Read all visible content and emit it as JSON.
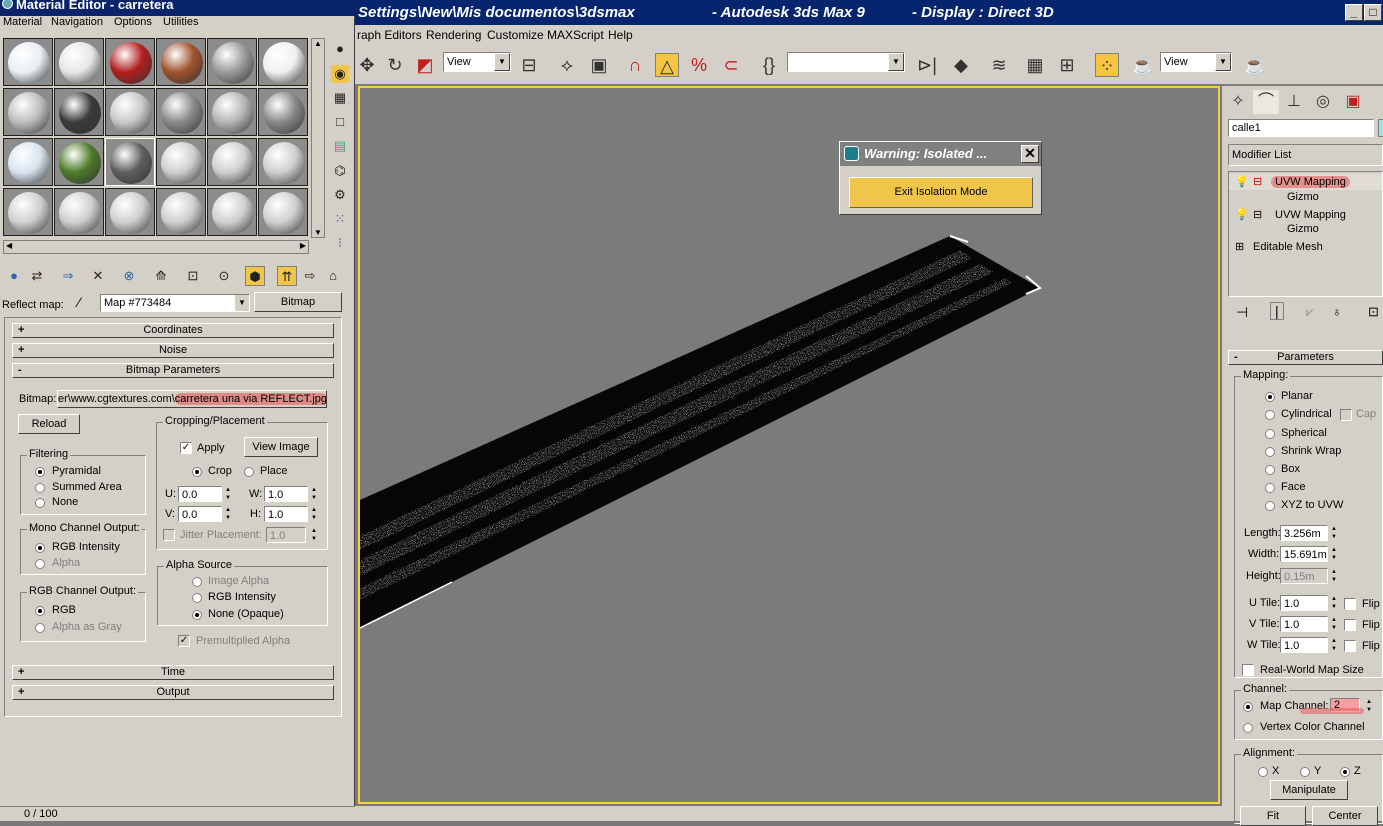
{
  "max_window": {
    "title_path": "Settings\\New\\Mis documentos\\3dsmax",
    "title_app": "- Autodesk 3ds Max 9",
    "title_display": "- Display : Direct 3D",
    "minimize": "_",
    "restore": "□",
    "menu": [
      "raph Editors",
      "Rendering",
      "Customize",
      "MAXScript",
      "Help"
    ],
    "toolbar": {
      "ref_coord": "View",
      "named_selection": "",
      "render_view": "View"
    }
  },
  "warning_dialog": {
    "title": "Warning: Isolated ...",
    "close": "✕",
    "button": "Exit Isolation Mode"
  },
  "material_editor": {
    "title": "Material Editor - carretera",
    "menu": [
      "Material",
      "Navigation",
      "Options",
      "Utilities"
    ],
    "slot_colors": [
      [
        "#e8eef4",
        "#e6e6e6",
        "#b21e1e",
        "#a0522d",
        "#9a9a9a",
        "#f0f0f0"
      ],
      [
        "#bdbdbd",
        "#3a3a3a",
        "#c8c8c8",
        "#8a8a8a",
        "#b5b5b5",
        "#888888"
      ],
      [
        "#d8e4ee",
        "#4e7a2a",
        "#5e5e5e",
        "#cfcfcf",
        "#cfcfcf",
        "#cfcfcf"
      ],
      [
        "#cfcfcf",
        "#cfcfcf",
        "#cfcfcf",
        "#cfcfcf",
        "#cfcfcf",
        "#cfcfcf"
      ]
    ],
    "reflect_label": "Reflect map:",
    "map_name": "Map #773484",
    "map_type": "Bitmap",
    "rollouts": {
      "coordinates": "Coordinates",
      "noise": "Noise",
      "bitmap_params": "Bitmap Parameters",
      "time": "Time",
      "output": "Output"
    },
    "bitmap_label": "Bitmap:",
    "bitmap_path_prefix": "er\\www.cgtextures.com\\",
    "bitmap_path_file": "carretera una via REFLECT.jpg",
    "reload": "Reload",
    "filtering": {
      "title": "Filtering",
      "options": [
        "Pyramidal",
        "Summed Area",
        "None"
      ]
    },
    "mono_output": {
      "title": "Mono Channel Output:",
      "options": [
        "RGB Intensity",
        "Alpha"
      ]
    },
    "rgb_output": {
      "title": "RGB Channel Output:",
      "options": [
        "RGB",
        "Alpha as Gray"
      ]
    },
    "cropping": {
      "title": "Cropping/Placement",
      "apply": "Apply",
      "view_image": "View Image",
      "crop": "Crop",
      "place": "Place",
      "u_label": "U:",
      "u": "0.0",
      "v_label": "V:",
      "v": "0.0",
      "w_label": "W:",
      "w": "1.0",
      "h_label": "H:",
      "h": "1.0",
      "jitter": "Jitter Placement:",
      "jitter_val": "1.0"
    },
    "alpha_source": {
      "title": "Alpha Source",
      "options": [
        "Image Alpha",
        "RGB Intensity",
        "None (Opaque)"
      ]
    },
    "premultiplied": "Premultiplied Alpha",
    "timebar": "0 / 100"
  },
  "command_panel": {
    "object_name": "calle1",
    "modifier_list": "Modifier List",
    "stack": [
      {
        "name": "UVW Mapping",
        "sub": "Gizmo"
      },
      {
        "name": "UVW Mapping",
        "sub": "Gizmo"
      },
      {
        "name": "Editable Mesh"
      }
    ],
    "parameters": "Parameters",
    "mapping_title": "Mapping:",
    "mapping_options": [
      "Planar",
      "Cylindrical",
      "Spherical",
      "Shrink Wrap",
      "Box",
      "Face",
      "XYZ to UVW"
    ],
    "cap": "Cap",
    "length_label": "Length:",
    "length": "3.256m",
    "width_label": "Width:",
    "width": "15.691m",
    "height_label": "Height:",
    "height": "0.15m",
    "utile_label": "U Tile:",
    "utile": "1.0",
    "vtile_label": "V Tile:",
    "vtile": "1.0",
    "wtile_label": "W Tile:",
    "wtile": "1.0",
    "flip": "Flip",
    "real_world": "Real-World Map Size",
    "channel_title": "Channel:",
    "map_channel": "Map Channel:",
    "map_channel_val": "2",
    "vertex_color": "Vertex Color Channel",
    "alignment_title": "Alignment:",
    "align_x": "X",
    "align_y": "Y",
    "align_z": "Z",
    "manipulate": "Manipulate",
    "fit": "Fit",
    "center": "Center"
  }
}
